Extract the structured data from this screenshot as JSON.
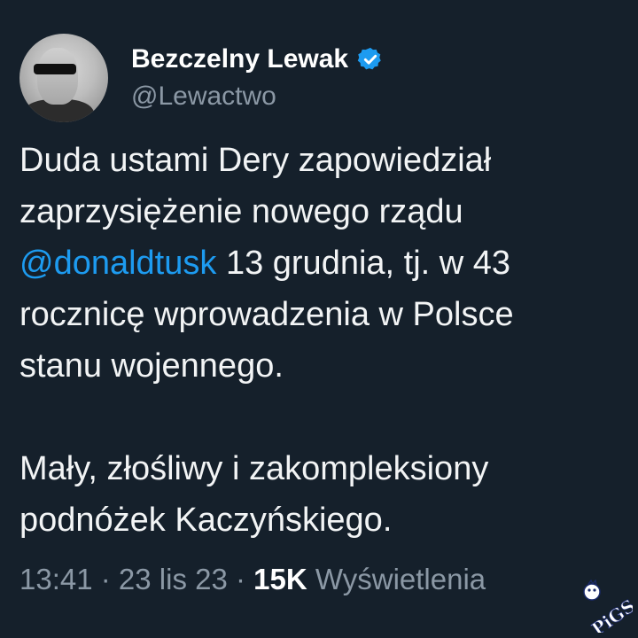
{
  "author": {
    "display_name": "Bezczelny Lewak",
    "handle": "@Lewactwo",
    "verified": true
  },
  "tweet": {
    "line1": "Duda ustami Dery zapowiedział",
    "line2": "zaprzysiężenie nowego rządu",
    "mention": "@donaldtusk",
    "line3_rest": " 13 grudnia, tj. w 43",
    "line4": "rocznicę wprowadzenia w Polsce",
    "line5": "stanu wojennego.",
    "line6": "Mały, złośliwy i zakompleksiony",
    "line7": "podnóżek Kaczyńskiego."
  },
  "meta": {
    "time": "13:41",
    "sep1": " · ",
    "date": "23 lis 23",
    "sep2": " · ",
    "views_count": "15K",
    "views_label": " Wyświetlenia"
  },
  "watermark": {
    "text": "PiGS"
  },
  "colors": {
    "background": "#15202b",
    "accent": "#1d9bf0",
    "muted": "#8b98a5"
  }
}
